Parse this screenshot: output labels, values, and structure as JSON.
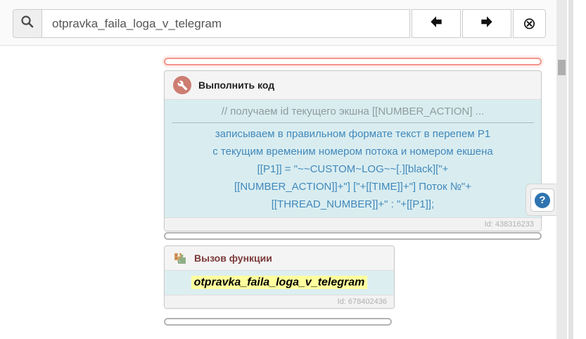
{
  "toolbar": {
    "search_value": "otpravka_faila_loga_v_telegram",
    "clear_glyph": "⊗"
  },
  "cards": {
    "execute_code": {
      "title": "Выполнить код",
      "comment_line": "// получаем id текущего экшна [[NUMBER_ACTION] ...",
      "code_lines": [
        "записываем в правильном формате текст в перепем P1",
        "с текущим временим номером потока и номером екшена",
        "[[P1]] = \"~~CUSTOM~LOG~~[.][black][\"+",
        "[[NUMBER_ACTION]]+\"] [\"+[[TIME]]+\"] Поток №\"+",
        "[[THREAD_NUMBER]]+\" : \"+[[P1]];"
      ],
      "id_label": "Id: 438316233"
    },
    "function_call": {
      "title": "Вызов функции",
      "function_name": "otpravka_faila_loga_v_telegram",
      "id_label": "Id: 678402436"
    }
  },
  "help": {
    "glyph": "?"
  },
  "colors": {
    "drop_indicator_active": "#f0958d",
    "drop_indicator_idle": "#b3b3b3",
    "code_background": "#d9edf0",
    "code_text_blue": "#4288bb",
    "code_comment_gray": "#8f9b9e",
    "function_title_maroon": "#7c3a3a",
    "function_highlight_yellow": "#ffff9e",
    "wrench_badge_salmon": "#cd7d72",
    "help_circle_blue": "#2f74b0"
  }
}
